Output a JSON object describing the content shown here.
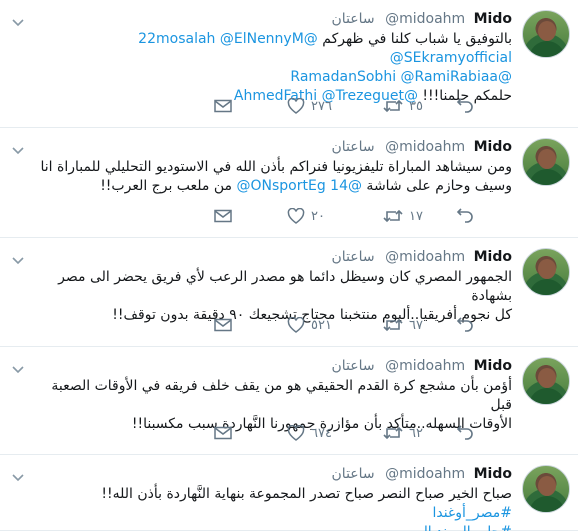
{
  "tweets": [
    {
      "name": "Mido",
      "handle": "@midoahm",
      "time": "ساعتان",
      "lines": [
        [
          {
            "t": "بالتوفيق يا شباب كلنا في ظهركم ",
            "c": "text"
          },
          {
            "t": "@22mosalah",
            "c": "mention"
          },
          {
            "t": " ",
            "c": "text"
          },
          {
            "t": "@ElNennyM",
            "c": "mention"
          },
          {
            "t": " ",
            "c": "text"
          },
          {
            "t": "@SEkramyofficial",
            "c": "mention"
          }
        ],
        [
          {
            "t": "@RamadanSobhi",
            "c": "mention"
          },
          {
            "t": " ",
            "c": "text"
          },
          {
            "t": "@RamiRabiaa",
            "c": "mention"
          }
        ],
        [
          {
            "t": "حلمكم حلمنا!!! ",
            "c": "text"
          },
          {
            "t": "@AhmedFathi",
            "c": "mention"
          },
          {
            "t": " ",
            "c": "text"
          },
          {
            "t": "@Trezeguet",
            "c": "mention"
          }
        ]
      ],
      "reply": "",
      "retweets": "٣٥",
      "likes": "٢٧٦"
    },
    {
      "name": "Mido",
      "handle": "@midoahm",
      "time": "ساعتان",
      "lines": [
        [
          {
            "t": "ومن سيشاهد المباراة تليفزيونيا فنراكم بأذن الله في الاستوديو التحليلي للمباراة انا",
            "c": "text"
          }
        ],
        [
          {
            "t": "وسيف وحازم على شاشة ",
            "c": "text"
          },
          {
            "t": "@ONsportEg",
            "c": "mention"
          },
          {
            "t": " ",
            "c": "text"
          },
          {
            "t": "14@",
            "c": "mention"
          },
          {
            "t": " من ملعب برج العرب!!",
            "c": "text"
          }
        ]
      ],
      "reply": "",
      "retweets": "١٧",
      "likes": "٢٠"
    },
    {
      "name": "Mido",
      "handle": "@midoahm",
      "time": "ساعتان",
      "lines": [
        [
          {
            "t": "الجمهور المصري كان وسيظل دائما هو مصدر الرعب لأي فريق يحضر الى مصر بشهادة",
            "c": "text"
          }
        ],
        [
          {
            "t": "كل نجوم أفريقيا..أليوم منتخبنا محتاج تشجيعك ٩٠ دقيقة بدون توقف!!",
            "c": "text"
          }
        ]
      ],
      "reply": "",
      "retweets": "٦٧",
      "likes": "٥٢١"
    },
    {
      "name": "Mido",
      "handle": "@midoahm",
      "time": "ساعتان",
      "lines": [
        [
          {
            "t": "أؤمن بأن مشجع كرة القدم الحقيقي هو من يقف خلف فريقه في الأوقات الصعبة قبل",
            "c": "text"
          }
        ],
        [
          {
            "t": "الأوقات السهله..متأكد بأن مؤازرة جمهورنا النَّهاردة سبب مكسبنا!!",
            "c": "text"
          }
        ]
      ],
      "reply": "",
      "retweets": "٦٢",
      "likes": "٦٧٤"
    },
    {
      "name": "Mido",
      "handle": "@midoahm",
      "time": "ساعتان",
      "lines": [
        [
          {
            "t": "صباح الخير صباح النصر صباح تصدر المجموعة بنهاية النَّهاردة بأذن الله!! ",
            "c": "text"
          },
          {
            "t": "#مصر_أوغندا",
            "c": "hashtag"
          }
        ],
        [
          {
            "t": "#حلم_المونديال",
            "c": "hashtag"
          }
        ]
      ],
      "reply": "",
      "retweets": "",
      "likes": ""
    }
  ],
  "icons": {
    "reply": "reply-icon",
    "retweet": "retweet-icon",
    "like": "heart-icon",
    "mail": "envelope-icon",
    "more": "chevron-down-icon"
  },
  "colors": {
    "link": "#1b95e0",
    "muted": "#657786",
    "text": "#14171a",
    "divider": "#e6ecf0"
  }
}
